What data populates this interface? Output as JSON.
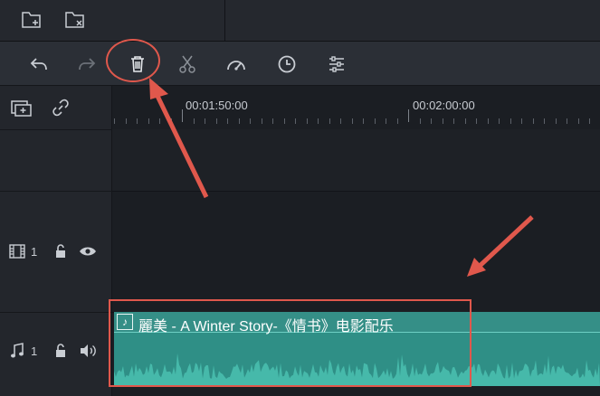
{
  "topbar": {
    "icons": [
      "add-folder-icon",
      "remove-folder-icon"
    ]
  },
  "toolbar": {
    "icons": [
      "undo-icon",
      "redo-icon",
      "delete-icon",
      "cut-icon",
      "speed-icon",
      "duration-icon",
      "adjust-icon"
    ]
  },
  "timeline": {
    "ruler": [
      "00:01:50:00",
      "00:02:00:00"
    ],
    "tracks": [
      {
        "type": "video",
        "number": "1"
      },
      {
        "type": "audio",
        "number": "1"
      }
    ],
    "clip": {
      "title": "麗美 - A Winter Story-《情书》电影配乐",
      "color": "#2f8f86"
    }
  },
  "annotations": {
    "color": "#e0584c"
  }
}
